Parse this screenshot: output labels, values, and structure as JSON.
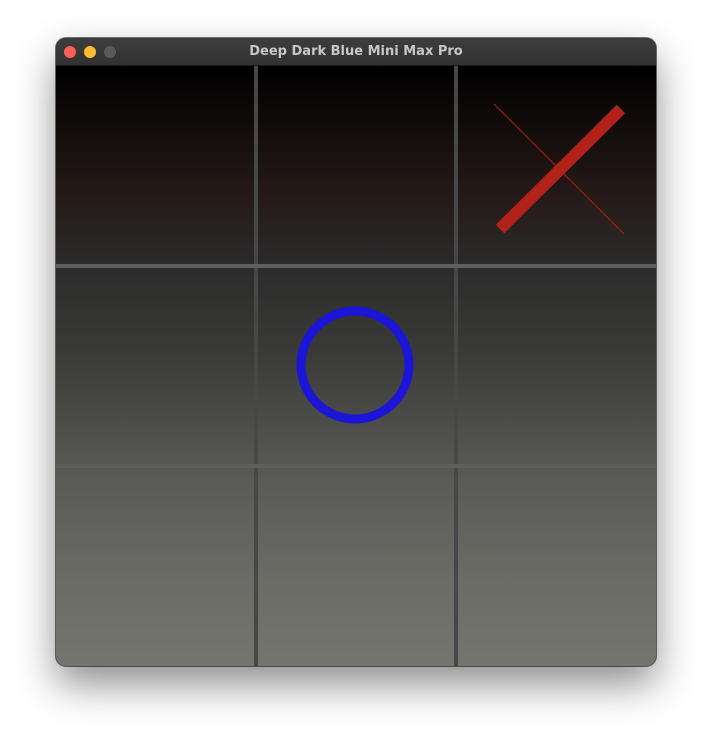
{
  "window": {
    "title": "Deep Dark Blue Mini Max Pro"
  },
  "colors": {
    "close": "#fe5f57",
    "minimize": "#febc2e",
    "zoom_disabled": "#5a5a5a",
    "x_mark": "#b22218",
    "o_mark": "#1c14d6",
    "grid_vertical": "#474747",
    "grid_horizontal": "#5e5e5e"
  },
  "board": {
    "cells": [
      {
        "row": 0,
        "col": 0,
        "mark": ""
      },
      {
        "row": 0,
        "col": 1,
        "mark": ""
      },
      {
        "row": 0,
        "col": 2,
        "mark": "X"
      },
      {
        "row": 1,
        "col": 0,
        "mark": ""
      },
      {
        "row": 1,
        "col": 1,
        "mark": "O"
      },
      {
        "row": 1,
        "col": 2,
        "mark": ""
      },
      {
        "row": 2,
        "col": 0,
        "mark": ""
      },
      {
        "row": 2,
        "col": 1,
        "mark": ""
      },
      {
        "row": 2,
        "col": 2,
        "mark": ""
      }
    ]
  }
}
